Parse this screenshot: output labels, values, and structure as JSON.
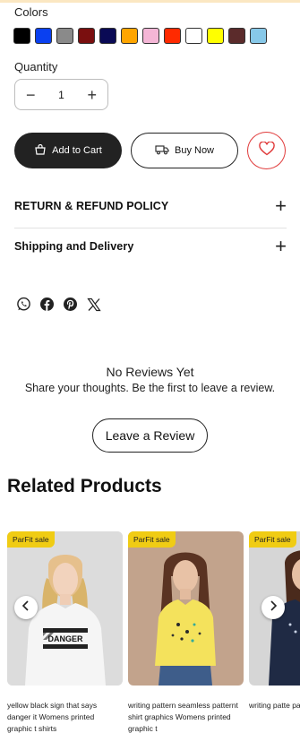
{
  "colors": {
    "label": "Colors",
    "swatches": [
      "#000000",
      "#0a40f0",
      "#8a8a8a",
      "#7a0f0f",
      "#0a0a55",
      "#ffa500",
      "#f4b6d6",
      "#ff2a00",
      "#ffffff",
      "#ffff00",
      "#5b2b2b",
      "#87c8e8"
    ]
  },
  "quantity": {
    "label": "Quantity",
    "value": "1",
    "minus": "−",
    "plus": "+"
  },
  "actions": {
    "add_to_cart": "Add to Cart",
    "buy_now": "Buy Now"
  },
  "accordions": [
    {
      "title": "RETURN & REFUND POLICY",
      "icon": "+"
    },
    {
      "title": "Shipping and Delivery",
      "icon": "+"
    }
  ],
  "share_icons": [
    "whatsapp-icon",
    "facebook-icon",
    "pinterest-icon",
    "x-icon"
  ],
  "reviews": {
    "title": "No Reviews Yet",
    "subtitle": "Share your thoughts. Be the first to leave a review.",
    "button": "Leave a Review"
  },
  "related": {
    "title": "Related Products",
    "products": [
      {
        "badge": "ParFit sale",
        "text": "yellow black sign that says danger it Womens printed graphic t shirts",
        "shirt_text": "DANGER"
      },
      {
        "badge": "ParFit sale",
        "text": "writing pattern seamless patternt shirt graphics Womens printed graphic t",
        "shirt_text": ""
      },
      {
        "badge": "ParFit sale",
        "text": "writing patte pattern hear",
        "shirt_text": ""
      }
    ]
  }
}
